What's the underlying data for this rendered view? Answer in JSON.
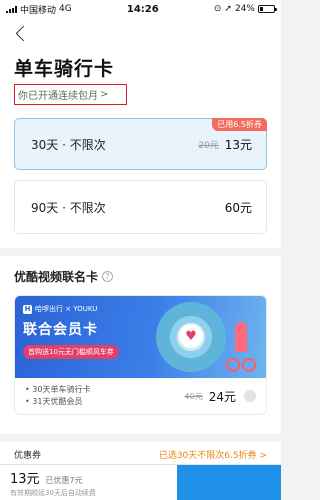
{
  "status": {
    "carrier": "中国移动",
    "network": "4G",
    "time": "14:26",
    "battery": "24%"
  },
  "page": {
    "title": "单车骑行卡",
    "subscribe_link": "你已开通连续包月",
    "chevron": ">"
  },
  "plans": [
    {
      "name": "30天 · 不限次",
      "old_price": "20元",
      "price": "13元",
      "badge": "已用6.5折券"
    },
    {
      "name": "90天 · 不限次",
      "price": "60元"
    }
  ],
  "video_card": {
    "section_title": "优酷视频联名卡",
    "help": "?",
    "brand": "哈啰出行 × YOUKU",
    "title": "联合会员卡",
    "pill": "首购送10元无门槛顺风车券",
    "benefits": [
      "• 30天单车骑行卡",
      "• 31天优酷会员"
    ],
    "old_price": "40元",
    "price": "24元"
  },
  "coupon": {
    "label": "优惠券",
    "value": "已选30天不限次6.5折券 >"
  },
  "bottom": {
    "total": "13元",
    "discount": "已优惠7元",
    "note": "有效期顺延30天后自动续费"
  },
  "colors": {
    "accent": "#1f8fe8",
    "badge": "#f36b5d",
    "coupon": "#e8870f",
    "highlight_border": "#d61f26"
  }
}
